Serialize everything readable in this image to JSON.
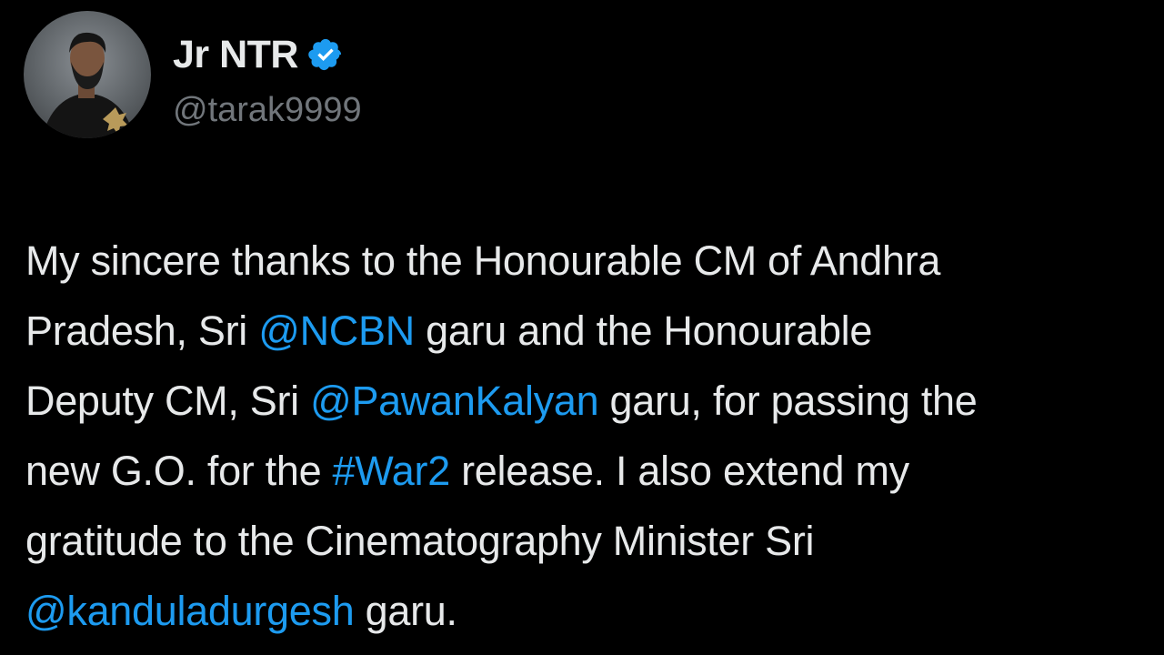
{
  "tweet": {
    "display_name": "Jr NTR",
    "handle": "@tarak9999",
    "verified": true,
    "accent_color": "#1d9bf0",
    "lines": [
      [
        {
          "text": "My sincere thanks to the Honourable CM of Andhra",
          "kind": "text"
        }
      ],
      [
        {
          "text": "Pradesh, Sri ",
          "kind": "text"
        },
        {
          "text": "@NCBN",
          "kind": "mention"
        },
        {
          "text": " garu and the Honourable",
          "kind": "text"
        }
      ],
      [
        {
          "text": "Deputy CM, Sri ",
          "kind": "text"
        },
        {
          "text": "@PawanKalyan",
          "kind": "mention"
        },
        {
          "text": " garu, for passing the",
          "kind": "text"
        }
      ],
      [
        {
          "text": "new G.O. for the ",
          "kind": "text"
        },
        {
          "text": "#War2",
          "kind": "hashtag"
        },
        {
          "text": " release. I also extend my",
          "kind": "text"
        }
      ],
      [
        {
          "text": "gratitude to the Cinematography Minister Sri",
          "kind": "text"
        }
      ],
      [
        {
          "text": "@kanduladurgesh",
          "kind": "mention"
        },
        {
          "text": " garu.",
          "kind": "text"
        }
      ]
    ]
  }
}
